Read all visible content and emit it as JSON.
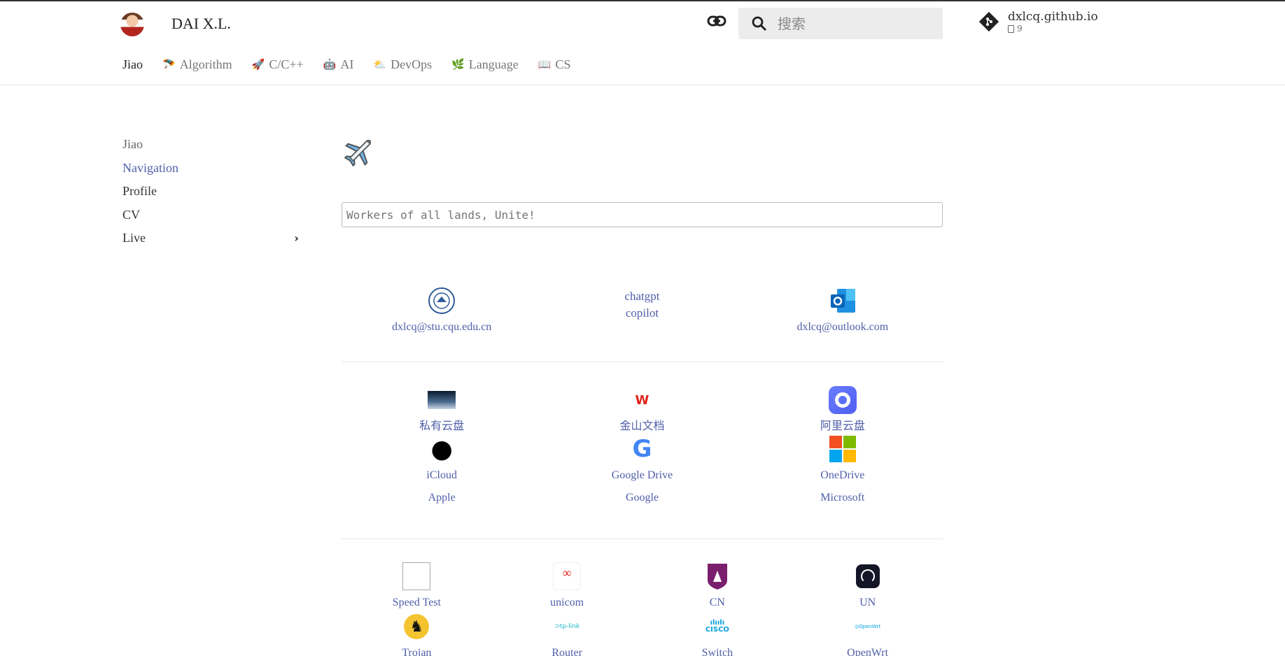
{
  "header": {
    "title": "DAI X.L.",
    "search_placeholder": "搜索",
    "repo_name": "dxlcq.github.io",
    "repo_count": "9"
  },
  "tabs": [
    {
      "label": "Jiao",
      "icon": ""
    },
    {
      "label": "Algorithm",
      "icon": "parachute-icon"
    },
    {
      "label": "C/C++",
      "icon": "rocket-icon"
    },
    {
      "label": "AI",
      "icon": "robot-icon"
    },
    {
      "label": "DevOps",
      "icon": "cloud-icon"
    },
    {
      "label": "Language",
      "icon": "leaf-icon"
    },
    {
      "label": "CS",
      "icon": "book-icon"
    }
  ],
  "sidebar": [
    "Jiao",
    "Navigation",
    "Profile",
    "CV",
    "Live"
  ],
  "motto": "Workers of all lands, Unite!",
  "section1": [
    {
      "label": "dxlcq@stu.cqu.edu.cn"
    },
    {
      "label": "chatgpt",
      "label2": "copilot"
    },
    {
      "label": "dxlcq@outlook.com"
    }
  ],
  "section2": [
    {
      "label": "私有云盘"
    },
    {
      "label": "金山文档"
    },
    {
      "label": "阿里云盘"
    },
    {
      "label": "iCloud",
      "label2": "Apple"
    },
    {
      "label": "Google Drive",
      "label2": "Google"
    },
    {
      "label": "OneDrive",
      "label2": "Microsoft"
    }
  ],
  "section3": [
    {
      "label": "Speed Test"
    },
    {
      "label": "unicom"
    },
    {
      "label": "CN"
    },
    {
      "label": "UN"
    },
    {
      "label": "Trojan"
    },
    {
      "label": "Router"
    },
    {
      "label": "Switch"
    },
    {
      "label": "OpenWrt"
    }
  ],
  "colors": {
    "link": "#4f5fa9",
    "accent_red": "#e2231a"
  }
}
